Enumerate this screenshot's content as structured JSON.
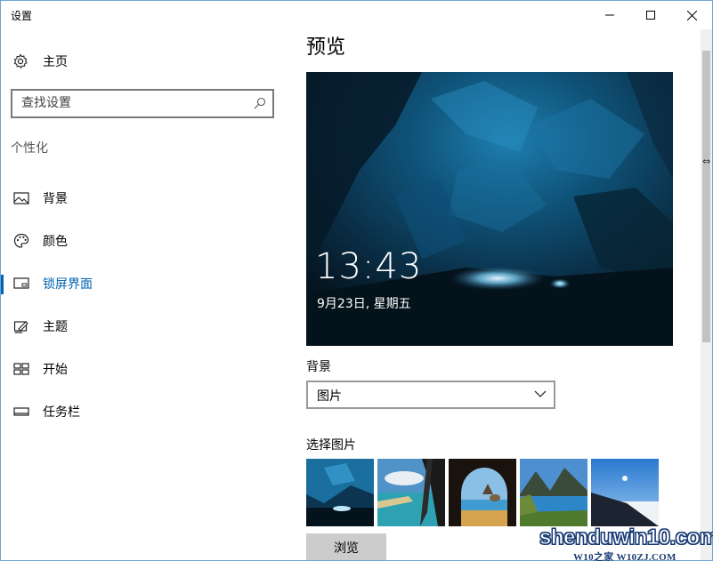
{
  "window": {
    "title": "设置",
    "controls": {
      "minimize": "minimize-icon",
      "maximize": "maximize-icon",
      "close": "close-icon"
    }
  },
  "sidebar": {
    "home_label": "主页",
    "home_icon": "gear-icon",
    "search": {
      "placeholder": "查找设置",
      "value": ""
    },
    "section_title": "个性化",
    "items": [
      {
        "label": "背景",
        "icon": "picture-icon",
        "active": false
      },
      {
        "label": "颜色",
        "icon": "palette-icon",
        "active": false
      },
      {
        "label": "锁屏界面",
        "icon": "lock-screen-icon",
        "active": true
      },
      {
        "label": "主题",
        "icon": "theme-brush-icon",
        "active": false
      },
      {
        "label": "开始",
        "icon": "start-grid-icon",
        "active": false
      },
      {
        "label": "任务栏",
        "icon": "taskbar-icon",
        "active": false
      }
    ]
  },
  "main": {
    "page_title": "预览",
    "preview": {
      "time": "13:43",
      "date": "9月23日, 星期五"
    },
    "background": {
      "label": "背景",
      "selected": "图片"
    },
    "choose_picture_label": "选择图片",
    "thumbnails": [
      "ice-cave",
      "beach-island",
      "cave-arch-beach",
      "mountain-lake",
      "moon-over-clouds"
    ],
    "browse_label": "浏览"
  },
  "colors": {
    "accent": "#0063b1",
    "window_border": "#6fa3d4"
  },
  "watermark": {
    "main": "shenduwin10.com",
    "sub": "W10之家 W10ZJ.COM"
  }
}
